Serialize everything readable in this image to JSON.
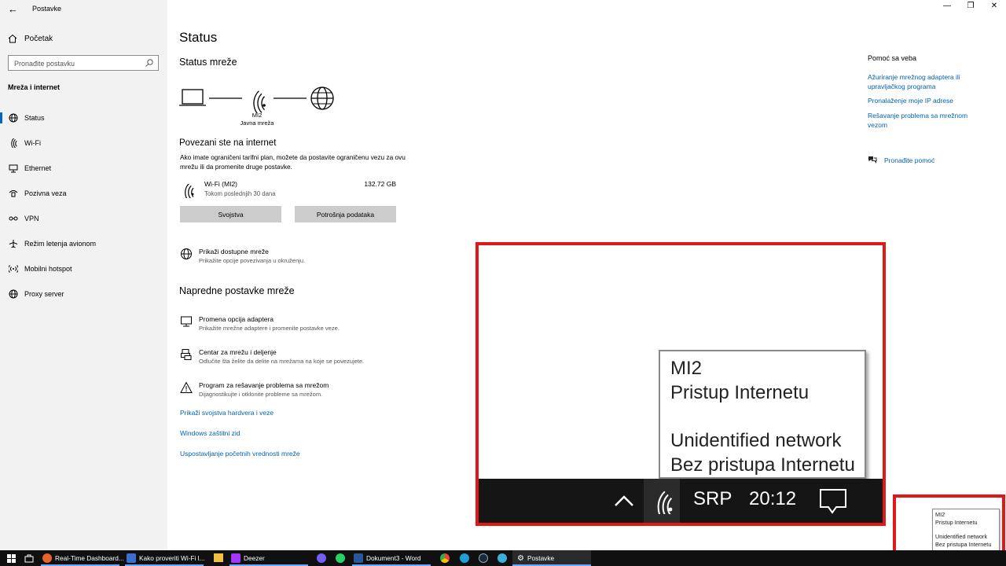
{
  "window": {
    "title": "Postavke",
    "back": "←",
    "min": "—",
    "max": "❐",
    "close": "✕"
  },
  "sidebar": {
    "home": "Početak",
    "search_placeholder": "Pronađite postavku",
    "section": "Mreža i internet",
    "items": [
      {
        "label": "Status",
        "icon": "globe-icon"
      },
      {
        "label": "Wi-Fi",
        "icon": "wifi-icon"
      },
      {
        "label": "Ethernet",
        "icon": "ethernet-icon"
      },
      {
        "label": "Pozivna veza",
        "icon": "dialup-icon"
      },
      {
        "label": "VPN",
        "icon": "vpn-icon"
      },
      {
        "label": "Režim letenja avionom",
        "icon": "airplane-icon"
      },
      {
        "label": "Mobilni hotspot",
        "icon": "hotspot-icon"
      },
      {
        "label": "Proxy server",
        "icon": "globe-icon"
      }
    ]
  },
  "main": {
    "title": "Status",
    "network_status": "Status mreže",
    "network_name": "MI2",
    "network_type": "Javna mreža",
    "connected_heading": "Povezani ste na internet",
    "connected_desc": "Ako imate ograničeni tarifni plan, možete da postavite ograničenu vezu za ovu mrežu ili da promenite druge postavke.",
    "connection": {
      "name": "Wi-Fi (MI2)",
      "period": "Tokom poslednjih 30 dana",
      "usage": "132.72 GB"
    },
    "btn_properties": "Svojstva",
    "btn_data_usage": "Potrošnja podataka",
    "show_networks": {
      "title": "Prikaži dostupne mreže",
      "desc": "Prikažite opcije povezivanja u okruženju."
    },
    "advanced_heading": "Napredne postavke mreže",
    "advanced": [
      {
        "title": "Promena opcija adaptera",
        "desc": "Prikažite mrežne adaptere i promenite postavke veze."
      },
      {
        "title": "Centar za mrežu i deljenje",
        "desc": "Odlučite šta želite da delite na mrežama na koje se povezujete."
      },
      {
        "title": "Program za rešavanje problema sa mrežom",
        "desc": "Dijagnostikujte i otklonite probleme sa mrežom."
      }
    ],
    "links": [
      "Prikaži svojstva hardvera i veze",
      "Windows zaštitni zid",
      "Uspostavljanje početnih vrednosti mreže"
    ]
  },
  "help": {
    "title": "Pomoć sa veba",
    "links": [
      "Ažuriranje mrežnog adaptera ili upravljačkog programa",
      "Pronalaženje moje IP adrese",
      "Rešavanje problema sa mrežnom vezom"
    ],
    "find_help": "Pronađite pomoć"
  },
  "tooltip": {
    "line1": "MI2",
    "line2": "Pristup Internetu",
    "line3": "Unidentified network",
    "line4": "Bez pristupa Internetu",
    "chevron": "^",
    "lang": "SRP",
    "time": "20:12"
  },
  "taskbar": {
    "items": [
      "Real-Time Dashboard...",
      "Kako proveriti Wi-Fi l...",
      "Deezer",
      "Dokument3 - Word",
      "Postavke"
    ]
  },
  "colors": {
    "accent": "#0067c0",
    "link": "#0063b1",
    "highlight": "#e01818",
    "taskbar": "#101010"
  }
}
